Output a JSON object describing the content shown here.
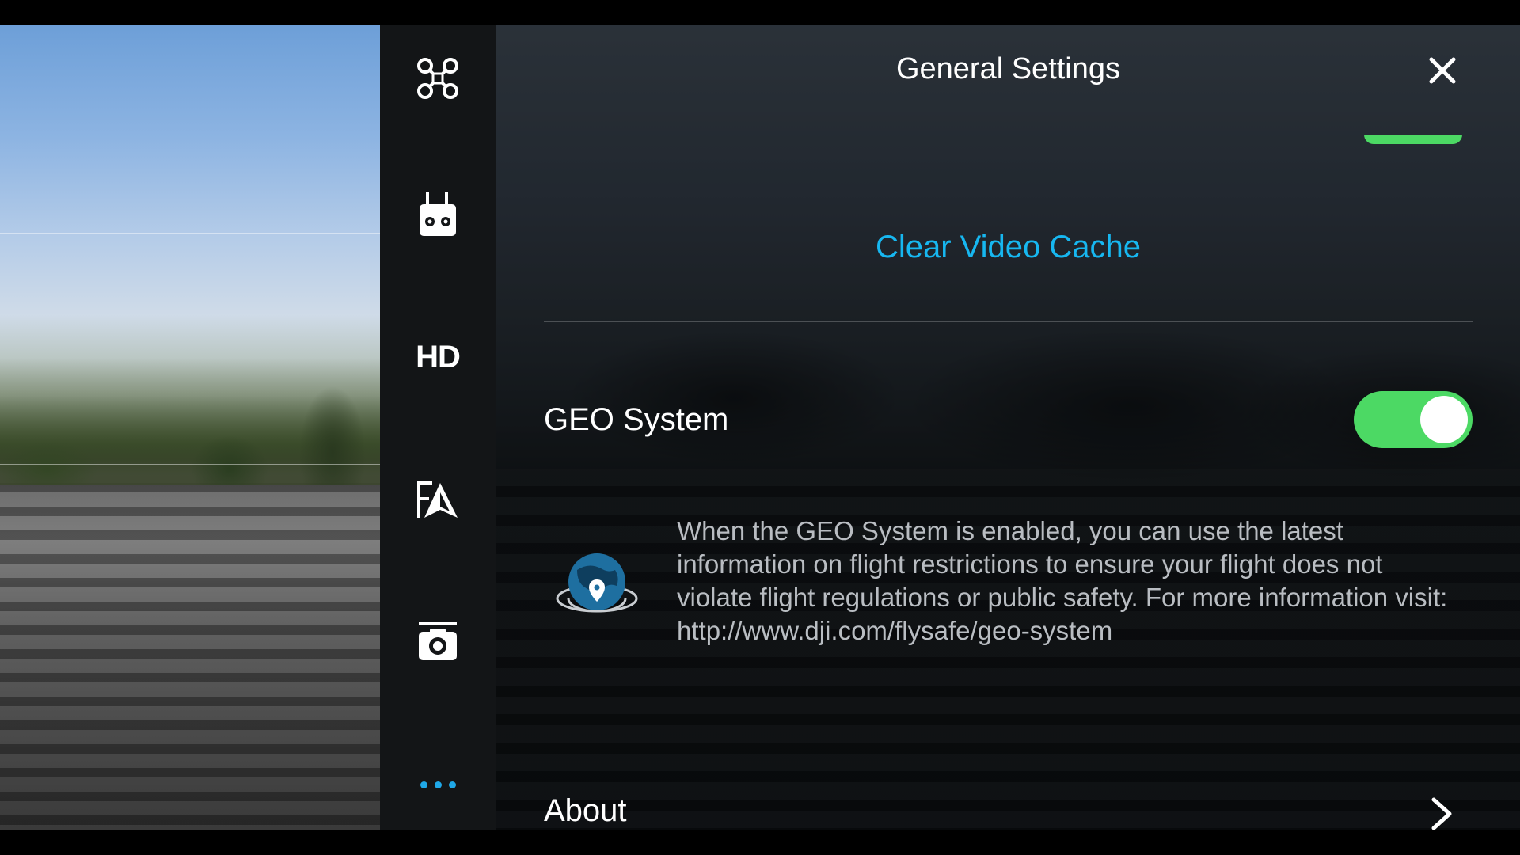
{
  "sidebar": {
    "items": [
      {
        "name": "aircraft-icon"
      },
      {
        "name": "remote-controller-icon"
      },
      {
        "name": "hd-transmission",
        "label": "HD"
      },
      {
        "name": "map-navigation-icon"
      },
      {
        "name": "camera-icon"
      },
      {
        "name": "more-icon"
      }
    ],
    "accent_color": "#1fa8e8"
  },
  "panel": {
    "title": "General Settings",
    "close_icon": "close-icon",
    "clear_video_cache_label": "Clear Video Cache",
    "geo_system": {
      "label": "GEO System",
      "enabled": true,
      "description": "When the GEO System is enabled, you can use the latest information on flight restrictions to ensure your flight does not violate flight regulations or public safety. For more information visit:",
      "link": "http://www.dji.com/flysafe/geo-system",
      "icon": "globe-location-icon"
    },
    "about_label": "About",
    "colors": {
      "toggle_on": "#4cd964",
      "link_blue": "#17b7f0"
    }
  }
}
